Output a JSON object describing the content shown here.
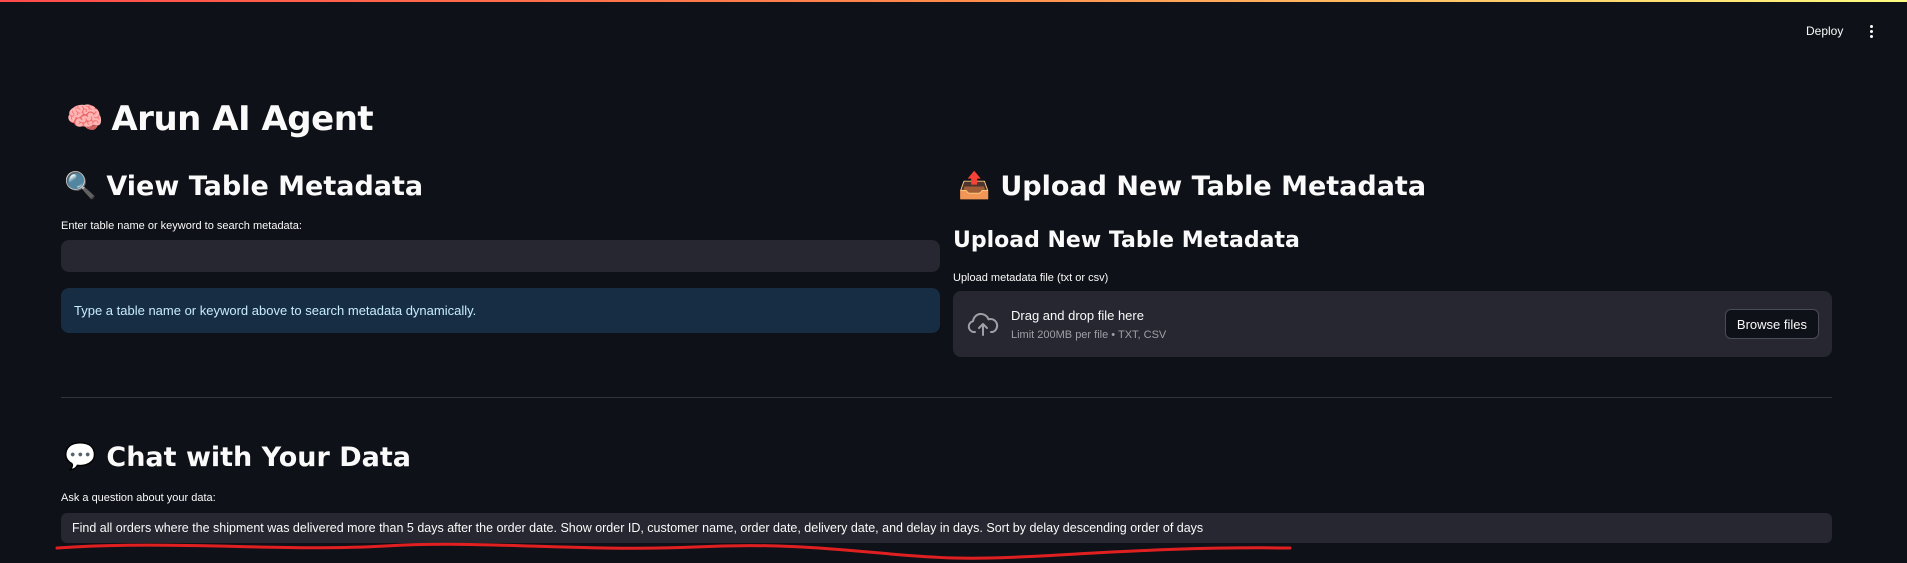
{
  "header": {
    "deploy_label": "Deploy",
    "menu_icon": "kebab-menu-icon"
  },
  "app": {
    "title": "Arun AI Agent",
    "title_emoji": "🧠"
  },
  "view_section": {
    "emoji": "🔍",
    "heading": "View Table Metadata",
    "search_label": "Enter table name or keyword to search metadata:",
    "search_value": "",
    "info_text": "Type a table name or keyword above to search metadata dynamically."
  },
  "upload_section": {
    "emoji": "📤",
    "heading": "Upload New Table Metadata",
    "subheading": "Upload New Table Metadata",
    "file_label": "Upload metadata file (txt or csv)",
    "dropzone_title": "Drag and drop file here",
    "dropzone_limit": "Limit 200MB per file • TXT, CSV",
    "browse_label": "Browse files",
    "upload_icon": "cloud-upload-icon"
  },
  "chat_section": {
    "emoji": "💬",
    "heading": "Chat with Your Data",
    "question_label": "Ask a question about your data:",
    "question_value": "Find all orders where the shipment was delivered more than 5 days after the order date. Show order ID, customer name, order date, delivery date, and delay in days. Sort by delay descending order of days"
  },
  "colors": {
    "background": "#0e1117",
    "input_bg": "#262730",
    "info_bg": "#172d43",
    "info_text": "#c7ebff",
    "annotation_red": "#e02020"
  }
}
